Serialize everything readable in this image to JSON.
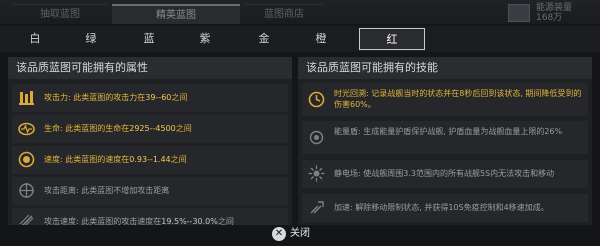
{
  "top_tabs": [
    {
      "label": "抽取蓝图"
    },
    {
      "label": "精英蓝图"
    },
    {
      "label": "蓝图商店"
    }
  ],
  "top_right": {
    "line1": "能源装量",
    "line2": "168万"
  },
  "color_tabs": [
    {
      "label": "白"
    },
    {
      "label": "绿"
    },
    {
      "label": "蓝"
    },
    {
      "label": "紫"
    },
    {
      "label": "金"
    },
    {
      "label": "橙"
    },
    {
      "label": "红"
    }
  ],
  "active_color_tab": "红",
  "attributes": {
    "title": "该品质蓝图可能拥有的属性",
    "items": [
      {
        "prefix": "攻击力: 此类蓝图的攻击力在",
        "value": "39--60",
        "suffix": "之间",
        "icon": "attack-icon"
      },
      {
        "prefix": "生命: 此类蓝图的生命在",
        "value": "2925--4500",
        "suffix": "之间",
        "icon": "health-icon"
      },
      {
        "prefix": "速度: 此类蓝图的速度在",
        "value": "0.93--1.44",
        "suffix": "之间",
        "icon": "speed-icon"
      },
      {
        "prefix": "攻击距离: 此类蓝图不增加攻击距离",
        "value": "",
        "suffix": "",
        "icon": "range-icon"
      },
      {
        "prefix": "攻击速度: 此类蓝图的攻击速度在",
        "value": "19.5%--30.0%",
        "suffix": "之间",
        "icon": "attack-speed-icon"
      }
    ]
  },
  "skills": {
    "title": "该品质蓝图可能拥有的技能",
    "items": [
      {
        "text": "时光回溯: 记录战舰当时的状态并在8秒后回到该状态, 期间降低受到的伤害60%。",
        "icon": "time-rewind-icon"
      },
      {
        "text": "能量盾: 生成能量护盾保护战舰, 护盾血量为战舰血量上限的26%",
        "icon": "energy-shield-icon"
      },
      {
        "text": "静电场: 使战舰周围3.3范围内的所有战舰5S内无法攻击和移动",
        "icon": "static-field-icon"
      },
      {
        "text": "加速: 解除移动限制状态, 并获得10S免疫控制和4移速加成。",
        "icon": "accelerate-icon"
      }
    ]
  },
  "close": {
    "label": "关闭"
  },
  "colors": {
    "gold": "#e2b53e",
    "grey": "#9a9ca1",
    "panel": "#1f2023"
  }
}
